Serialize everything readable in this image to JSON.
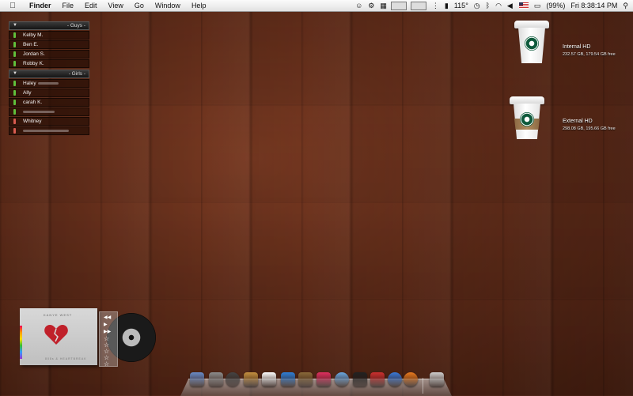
{
  "menubar": {
    "app": "Finder",
    "menus": [
      "File",
      "Edit",
      "View",
      "Go",
      "Window",
      "Help"
    ],
    "status": {
      "temperature": "115°",
      "battery": "(99%)",
      "clock": "Fri 8:38:14 PM"
    },
    "icons": [
      "apple-icon",
      "spotlight-icon"
    ]
  },
  "buddy_list": {
    "groups": [
      {
        "label": "- Guys -",
        "buddies": [
          "Kelby M.",
          "Ben E.",
          "Jordan S.",
          "Robby K."
        ]
      },
      {
        "label": "- Girls -",
        "buddies": [
          "Haley",
          "Ally",
          "carah K.",
          "",
          "Whitney",
          ""
        ]
      }
    ]
  },
  "drives": [
    {
      "name": "Internal HD",
      "info": "232.57 GB, 179.54 GB free"
    },
    {
      "name": "External HD",
      "info": "298.08 GB, 195.66 GB free"
    }
  ],
  "player": {
    "album_title": "KANYE WEST",
    "album_subtitle": "808s & HEARTBREAK",
    "controls": [
      "◀◀",
      "▶",
      "▶▶"
    ],
    "rating_stars": 5
  },
  "dock": {
    "icons": [
      "finder-icon",
      "system-preferences-icon",
      "dashboard-icon",
      "time-machine-icon",
      "ical-icon",
      "pages-icon",
      "iphoto-icon",
      "itunes-love-icon",
      "mail-icon",
      "photo-booth-icon",
      "photoshop-icon",
      "safari-icon",
      "firefox-icon",
      "trash-icon"
    ],
    "colors": [
      "#6a8cc8",
      "#8d8d8d",
      "#444444",
      "#c49040",
      "#ffffff",
      "#2f7fd6",
      "#8a6a3a",
      "#e03060",
      "#6aa8e0",
      "#222222",
      "#cc3030",
      "#3a7ad8",
      "#e87a20",
      "#cfcfcf"
    ]
  }
}
